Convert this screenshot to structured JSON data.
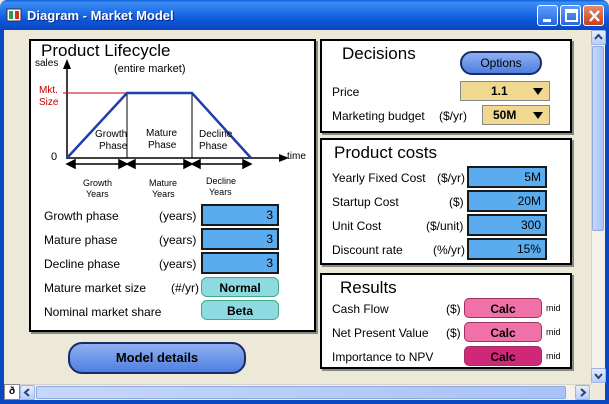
{
  "window": {
    "title": "Diagram - Market Model"
  },
  "lifecycle": {
    "title": "Product Lifecycle",
    "chart": {
      "y_axis_label": "sales",
      "subtitle": "(entire market)",
      "mkt_size_label_1": "Mkt.",
      "mkt_size_label_2": "Size",
      "zero_label": "0",
      "time_label": "time",
      "phase_growth_1": "Growth",
      "phase_growth_2": "Phase",
      "phase_mature_1": "Mature",
      "phase_mature_2": "Phase",
      "phase_decline_1": "Decline",
      "phase_decline_2": "Phase",
      "years_growth_1": "Growth",
      "years_growth_2": "Years",
      "years_mature_1": "Mature",
      "years_mature_2": "Years",
      "years_decline_1": "Decline",
      "years_decline_2": "Years"
    },
    "rows": [
      {
        "label": "Growth phase",
        "unit": "(years)",
        "value": "3"
      },
      {
        "label": "Mature phase",
        "unit": "(years)",
        "value": "3"
      },
      {
        "label": "Decline phase",
        "unit": "(years)",
        "value": "3"
      }
    ],
    "market_size": {
      "label": "Mature market size",
      "unit": "(#/yr)",
      "value": "Normal"
    },
    "market_share": {
      "label": "Nominal market share",
      "value": "Beta"
    }
  },
  "model_details_button": "Model details",
  "decisions": {
    "title": "Decisions",
    "options_button": "Options",
    "price": {
      "label": "Price",
      "value": "1.1"
    },
    "marketing": {
      "label": "Marketing budget",
      "unit": "($/yr)",
      "value": "50M"
    }
  },
  "costs": {
    "title": "Product costs",
    "rows": [
      {
        "label": "Yearly Fixed Cost",
        "unit": "($/yr)",
        "value": "5M"
      },
      {
        "label": "Startup Cost",
        "unit": "($)",
        "value": "20M"
      },
      {
        "label": "Unit Cost",
        "unit": "($/unit)",
        "value": "300"
      },
      {
        "label": "Discount rate",
        "unit": "(%/yr)",
        "value": "15%"
      }
    ]
  },
  "results": {
    "title": "Results",
    "rows": [
      {
        "label": "Cash Flow",
        "unit": "($)",
        "button": "Calc",
        "tag": "mid"
      },
      {
        "label": "Net Present Value",
        "unit": "($)",
        "button": "Calc",
        "tag": "mid"
      },
      {
        "label": "Importance to NPV",
        "unit": "",
        "button": "Calc",
        "tag": "mid"
      }
    ]
  },
  "status_icon": "ð"
}
